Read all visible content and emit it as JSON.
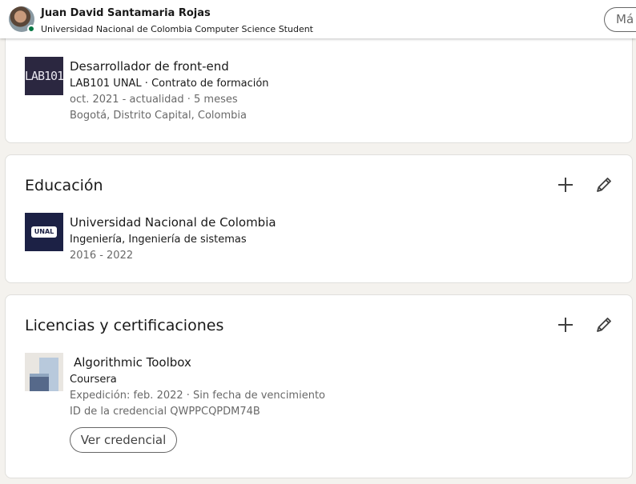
{
  "header": {
    "name": "Juan David Santamaria Rojas",
    "headline": "Universidad Nacional de Colombia Computer Science Student",
    "more_label": "Má"
  },
  "experience": {
    "logo_text": "LAB101",
    "title": "Desarrollador de front-end",
    "company": "LAB101 UNAL · Contrato de formación",
    "dates": "oct. 2021 - actualidad · 5 meses",
    "location": "Bogotá, Distrito Capital, Colombia"
  },
  "education": {
    "section_title": "Educación",
    "logo_text": "UNAL",
    "school": "Universidad Nacional de Colombia",
    "degree": "Ingeniería, Ingeniería de sistemas",
    "dates": "2016 - 2022"
  },
  "licenses": {
    "section_title": "Licencias y certificaciones",
    "title": "Algorithmic Toolbox",
    "issuer": "Coursera",
    "issued": "Expedición: feb. 2022 · Sin fecha de vencimiento",
    "credential_id": "ID de la credencial QWPPCQPDM74B",
    "button_label": "Ver credencial"
  },
  "icons": {
    "add": "plus-icon",
    "edit": "pencil-icon"
  },
  "colors": {
    "page_bg": "#f4f2ee",
    "presence": "#057642",
    "unal_logo": "#1c2145",
    "lab_logo": "#2b2740"
  }
}
